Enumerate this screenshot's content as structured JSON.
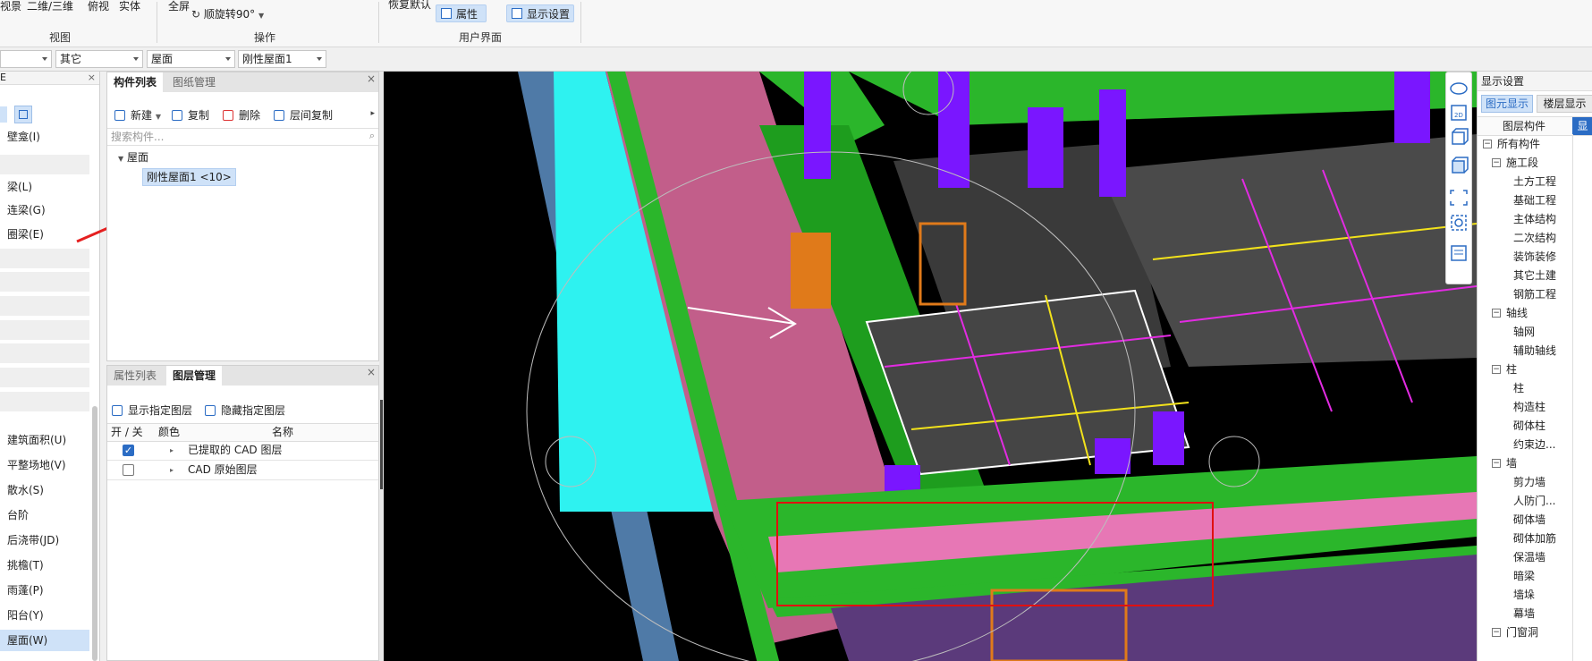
{
  "ribbon": {
    "view_row": [
      "视景",
      "二维/三维",
      "俯视",
      "实体"
    ],
    "view_group": "视图",
    "fullscreen": "全屏",
    "rotate": "顺旋转90°",
    "ops_group": "操作",
    "restore_default": "恢复默认",
    "properties": "属性",
    "display_settings": "显示设置",
    "ui_group": "用户界面"
  },
  "combos": [
    {
      "value": ""
    },
    {
      "value": "其它"
    },
    {
      "value": "屋面"
    },
    {
      "value": "刚性屋面1"
    }
  ],
  "left_nav": {
    "header": "E",
    "items_top": [
      "壁龛(I)",
      "",
      "梁(L)",
      "连梁(G)",
      "圈梁(E)"
    ],
    "items_bottom": [
      "建筑面积(U)",
      "平整场地(V)",
      "散水(S)",
      "台阶",
      "后浇带(JD)",
      "挑檐(T)",
      "雨蓬(P)",
      "阳台(Y)",
      "屋面(W)"
    ],
    "selected": "屋面(W)"
  },
  "component_panel": {
    "tabs": [
      "构件列表",
      "图纸管理"
    ],
    "toolbar": [
      "新建",
      "复制",
      "删除",
      "层间复制"
    ],
    "search_placeholder": "搜索构件...",
    "tree_root": "屋面",
    "tree_child": "刚性屋面1 <10>"
  },
  "layer_panel": {
    "tabs": [
      "属性列表",
      "图层管理"
    ],
    "toolbar": [
      "显示指定图层",
      "隐藏指定图层"
    ],
    "columns": [
      "开 / 关",
      "颜色",
      "名称"
    ],
    "rows": [
      {
        "checked": true,
        "name": "已提取的 CAD 图层"
      },
      {
        "checked": false,
        "name": "CAD 原始图层"
      }
    ]
  },
  "view_tools": [
    "orbit-icon",
    "2d-icon",
    "cube-icon",
    "cube-solid-icon",
    "fit-icon",
    "cube-settings-icon",
    "layer-list-icon"
  ],
  "display_panel": {
    "title": "显示设置",
    "tabs": [
      "图元显示",
      "楼层显示"
    ],
    "column_header": "图层构件",
    "column_header_2": "显",
    "tree": [
      {
        "label": "所有构件",
        "level": 0,
        "toggle": "−"
      },
      {
        "label": "施工段",
        "level": 1,
        "toggle": "−"
      },
      {
        "label": "土方工程",
        "level": 2
      },
      {
        "label": "基础工程",
        "level": 2
      },
      {
        "label": "主体结构",
        "level": 2
      },
      {
        "label": "二次结构",
        "level": 2
      },
      {
        "label": "装饰装修",
        "level": 2
      },
      {
        "label": "其它土建",
        "level": 2
      },
      {
        "label": "钢筋工程",
        "level": 2
      },
      {
        "label": "轴线",
        "level": 1,
        "toggle": "−"
      },
      {
        "label": "轴网",
        "level": 2
      },
      {
        "label": "辅助轴线",
        "level": 2
      },
      {
        "label": "柱",
        "level": 1,
        "toggle": "−"
      },
      {
        "label": "柱",
        "level": 2
      },
      {
        "label": "构造柱",
        "level": 2
      },
      {
        "label": "砌体柱",
        "level": 2
      },
      {
        "label": "约束边...",
        "level": 2
      },
      {
        "label": "墙",
        "level": 1,
        "toggle": "−"
      },
      {
        "label": "剪力墙",
        "level": 2
      },
      {
        "label": "人防门...",
        "level": 2
      },
      {
        "label": "砌体墙",
        "level": 2
      },
      {
        "label": "砌体加筋",
        "level": 2
      },
      {
        "label": "保温墙",
        "level": 2
      },
      {
        "label": "暗梁",
        "level": 2
      },
      {
        "label": "墙垛",
        "level": 2
      },
      {
        "label": "幕墙",
        "level": 2
      },
      {
        "label": "门窗洞",
        "level": 1,
        "toggle": "−"
      }
    ]
  },
  "colors": {
    "accent": "#2b6cc4",
    "selection": "#cfe2f8",
    "highlight_box": "#e01010"
  }
}
